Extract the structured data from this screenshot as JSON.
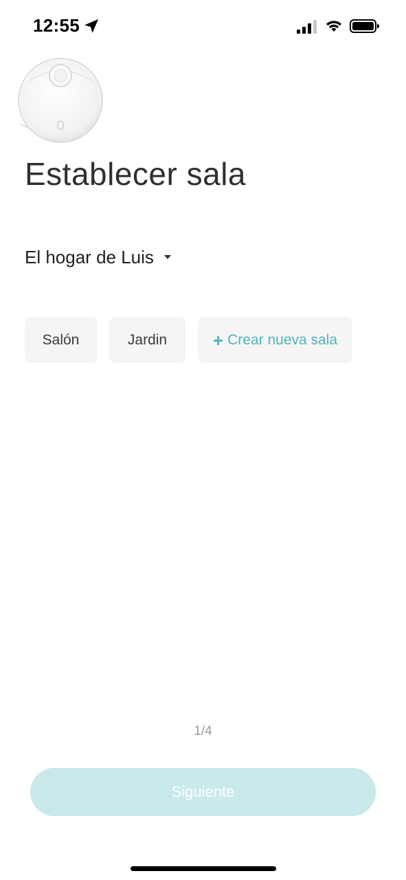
{
  "status_bar": {
    "time": "12:55",
    "icons": [
      "location-arrow-icon",
      "cellular-signal-icon",
      "wifi-icon",
      "battery-icon"
    ]
  },
  "device": {
    "image": "robot-vacuum-image"
  },
  "title": "Establecer sala",
  "home_selector": {
    "label": "El hogar de Luis",
    "icon": "chevron-down-icon"
  },
  "rooms": [
    {
      "label": "Salón"
    },
    {
      "label": "Jardin"
    }
  ],
  "create_room": {
    "icon": "+",
    "label": "Crear nueva sala"
  },
  "step": "1/4",
  "next_button": {
    "label": "Siguiente",
    "enabled": false
  },
  "colors": {
    "accent": "#4fb3bd",
    "button_disabled_bg": "#c9e9ea",
    "chip_bg": "#f5f5f5"
  }
}
